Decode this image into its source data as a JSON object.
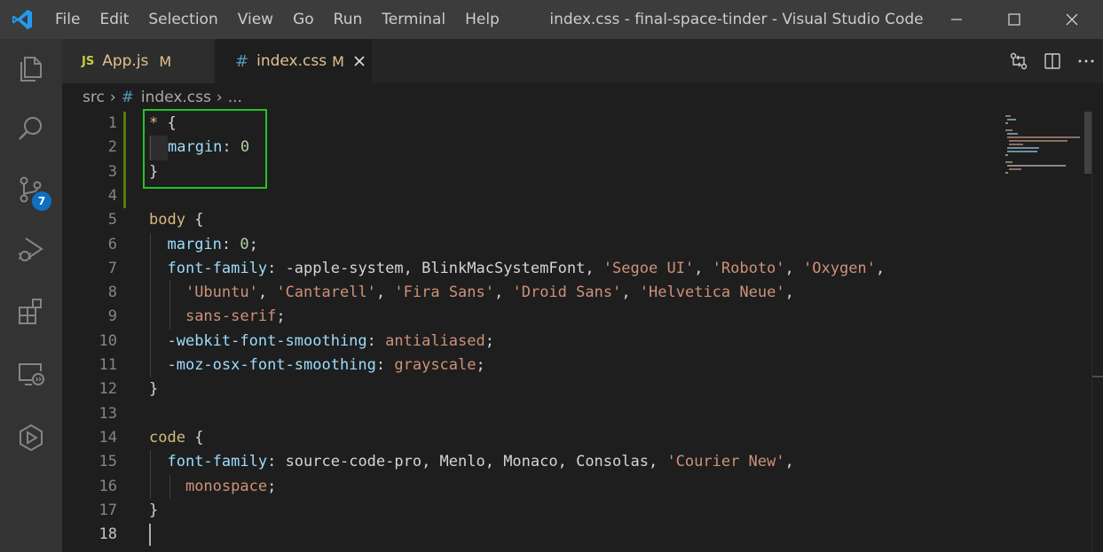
{
  "window": {
    "title": "index.css - final-space-tinder - Visual Studio Code"
  },
  "menu": [
    "File",
    "Edit",
    "Selection",
    "View",
    "Go",
    "Run",
    "Terminal",
    "Help"
  ],
  "activity_bar": {
    "icons": [
      "explorer-icon",
      "search-icon",
      "source-control-icon",
      "run-debug-icon",
      "extensions-icon",
      "remote-explorer-icon",
      "docker-icon"
    ],
    "source_control_badge": "7"
  },
  "tabs": [
    {
      "icon_text": "JS",
      "label": "App.js",
      "status": "M",
      "active": false
    },
    {
      "icon_text": "#",
      "label": "index.css",
      "status": "M",
      "active": true
    }
  ],
  "breadcrumb": {
    "folder": "src",
    "file_icon": "#",
    "file": "index.css",
    "more": "..."
  },
  "editor": {
    "line_numbers": [
      "1",
      "2",
      "3",
      "4",
      "5",
      "6",
      "7",
      "8",
      "9",
      "10",
      "11",
      "12",
      "13",
      "14",
      "15",
      "16",
      "17",
      "18"
    ],
    "current_line": "18",
    "code": {
      "l1_selector": "*",
      "l1_brace": " {",
      "l2_prop": "margin",
      "l2_colon": ": ",
      "l2_value": "0",
      "l3_brace": "}",
      "l5_selector": "body",
      "l5_brace": " {",
      "l6_prop": "margin",
      "l6_colon": ": ",
      "l6_value": "0",
      "l6_semi": ";",
      "l7_prop": "font-family",
      "l7_colon": ": ",
      "l7_plain": "-apple-system, BlinkMacSystemFont, ",
      "l7_s1": "'Segoe UI'",
      "l7_c1": ", ",
      "l7_s2": "'Roboto'",
      "l7_c2": ", ",
      "l7_s3": "'Oxygen'",
      "l7_c3": ",",
      "l8_s1": "'Ubuntu'",
      "l8_c1": ", ",
      "l8_s2": "'Cantarell'",
      "l8_c2": ", ",
      "l8_s3": "'Fira Sans'",
      "l8_c3": ", ",
      "l8_s4": "'Droid Sans'",
      "l8_c4": ", ",
      "l8_s5": "'Helvetica Neue'",
      "l8_c5": ",",
      "l9_value": "sans-serif",
      "l9_semi": ";",
      "l10_prop": "-webkit-font-smoothing",
      "l10_colon": ": ",
      "l10_value": "antialiased",
      "l10_semi": ";",
      "l11_prop": "-moz-osx-font-smoothing",
      "l11_colon": ": ",
      "l11_value": "grayscale",
      "l11_semi": ";",
      "l12_brace": "}",
      "l14_selector": "code",
      "l14_brace": " {",
      "l15_prop": "font-family",
      "l15_colon": ": ",
      "l15_plain": "source-code-pro, Menlo, Monaco, Consolas, ",
      "l15_s1": "'Courier New'",
      "l15_c1": ",",
      "l16_value": "monospace",
      "l16_semi": ";",
      "l17_brace": "}"
    }
  },
  "colors": {
    "title_bar": "#3c3c3c",
    "activity_bar": "#333333",
    "editor_bg": "#1e1e1e",
    "highlight_box": "#22c522",
    "badge": "#0e70c0",
    "modified": "#e2c08d"
  }
}
